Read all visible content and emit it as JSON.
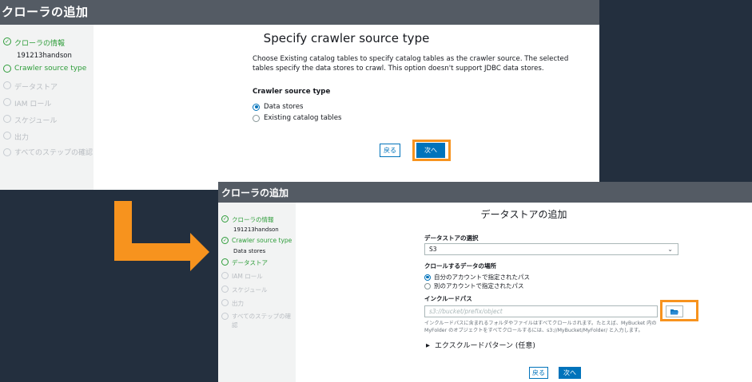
{
  "panel1": {
    "header_title": "クローラの追加",
    "steps": [
      {
        "label": "クローラの情報",
        "status": "done",
        "sub": "191213handson"
      },
      {
        "label": "Crawler source type",
        "status": "active",
        "sub": ""
      },
      {
        "label": "データストア",
        "status": "pending"
      },
      {
        "label": "IAM ロール",
        "status": "pending"
      },
      {
        "label": "スケジュール",
        "status": "pending"
      },
      {
        "label": "出力",
        "status": "pending"
      },
      {
        "label": "すべてのステップの確認",
        "status": "pending"
      }
    ],
    "title": "Specify crawler source type",
    "description": "Choose Existing catalog tables to specify catalog tables as the crawler source. The selected tables specify the data stores to crawl. This option doesn't support JDBC data stores.",
    "section_label": "Crawler source type",
    "options": [
      {
        "label": "Data stores",
        "selected": true
      },
      {
        "label": "Existing catalog tables",
        "selected": false
      }
    ],
    "back_label": "戻る",
    "next_label": "次へ"
  },
  "panel2": {
    "header_title": "クローラの追加",
    "steps": [
      {
        "label": "クローラの情報",
        "status": "done",
        "sub": "191213handson"
      },
      {
        "label": "Crawler source type",
        "status": "done",
        "sub": "Data stores"
      },
      {
        "label": "データストア",
        "status": "active"
      },
      {
        "label": "IAM ロール",
        "status": "pending"
      },
      {
        "label": "スケジュール",
        "status": "pending"
      },
      {
        "label": "出力",
        "status": "pending"
      },
      {
        "label": "すべてのステップの確認",
        "status": "pending"
      }
    ],
    "title": "データストアの追加",
    "datastore_label": "データストアの選択",
    "datastore_value": "S3",
    "crawl_location_label": "クロールするデータの場所",
    "location_options": [
      {
        "label": "自分のアカウントで指定されたパス",
        "selected": true
      },
      {
        "label": "別のアカウントで指定されたパス",
        "selected": false
      }
    ],
    "include_path_label": "インクルードパス",
    "include_path_placeholder": "s3://bucket/prefix/object",
    "help_line1": "インクルードパスに含まれるフォルダやファイルはすべてクロールされます。たとえば、MyBucket 内の",
    "help_line2": "MyFolder のオブジェクトをすべてクロールするには、s3://MyBucket/MyFolder/ と入力します。",
    "exclude_label": "エクスクルードパターン (任意)",
    "back_label": "戻る",
    "next_label": "次へ"
  },
  "colors": {
    "header": "#545b64",
    "accent_green": "#2e9d3a",
    "primary_blue": "#0073bb",
    "highlight_orange": "#f7931e",
    "page_bg": "#232f3e"
  },
  "icons": [
    "check-circle-icon",
    "circle-icon",
    "folder-icon",
    "caret-right-icon",
    "chevron-down-icon",
    "arrow-icon"
  ]
}
